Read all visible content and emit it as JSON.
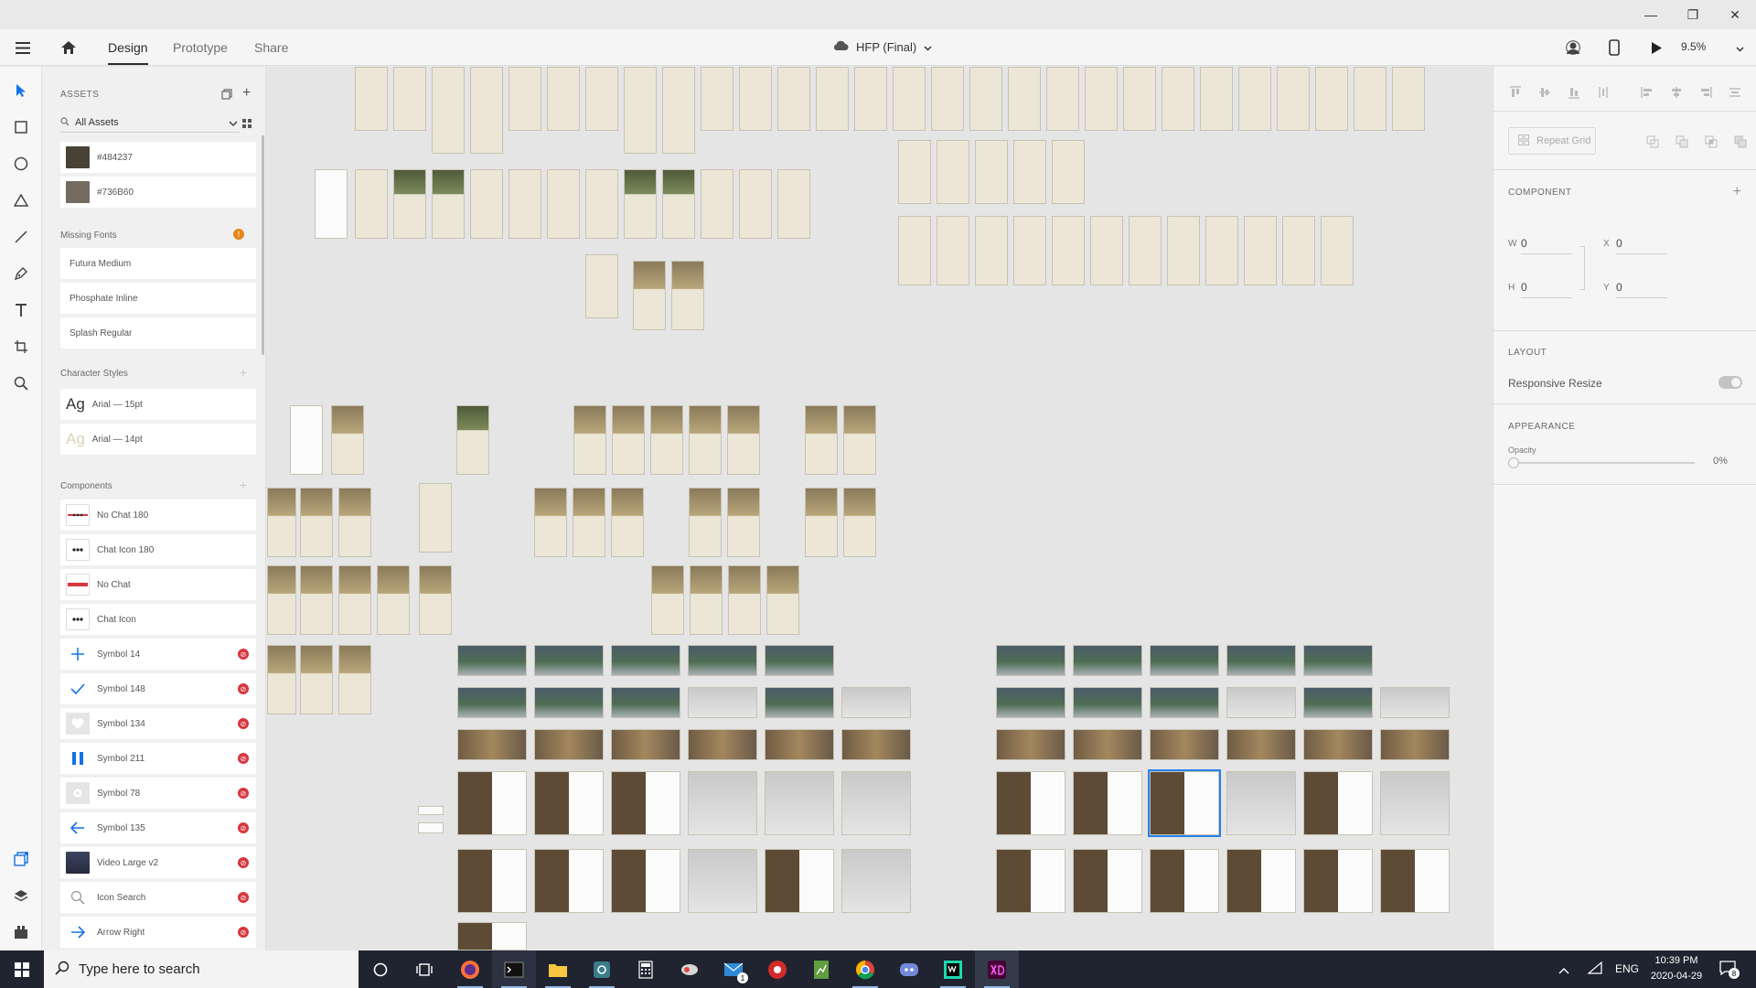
{
  "window": {
    "controls": {
      "minimize": "—",
      "restore": "❐",
      "close": "✕"
    }
  },
  "appbar": {
    "tabs": [
      {
        "label": "Design",
        "active": true
      },
      {
        "label": "Prototype",
        "active": false
      },
      {
        "label": "Share",
        "active": false
      }
    ],
    "document_title": "HFP (Final)",
    "zoom": "9.5%"
  },
  "assets_panel": {
    "header": "ASSETS",
    "filter_label": "All Assets",
    "colors": [
      {
        "label": "#484237",
        "hex": "#484237"
      },
      {
        "label": "#736B60",
        "hex": "#736B60"
      }
    ],
    "missing_fonts_label": "Missing Fonts",
    "missing_fonts_badge": "!",
    "missing_fonts": [
      "Futura Medium",
      "Phosphate Inline",
      "Splash Regular"
    ],
    "character_styles_label": "Character Styles",
    "character_styles": [
      {
        "glyph": "Ag",
        "label": "Arial — 15pt",
        "dim": false
      },
      {
        "glyph": "Ag",
        "label": "Arial — 14pt",
        "dim": true
      }
    ],
    "components_label": "Components",
    "components": [
      {
        "label": "No Chat 180",
        "icon": "no-chat-180-icon",
        "warn": false
      },
      {
        "label": "Chat Icon 180",
        "icon": "chat-dots-icon",
        "warn": false
      },
      {
        "label": "No Chat",
        "icon": "no-chat-icon",
        "warn": false
      },
      {
        "label": "Chat Icon",
        "icon": "chat-dots-icon",
        "warn": false
      },
      {
        "label": "Symbol 14",
        "icon": "plus-icon",
        "warn": true
      },
      {
        "label": "Symbol 148",
        "icon": "checkmark-icon",
        "warn": true
      },
      {
        "label": "Symbol 134",
        "icon": "heart-icon",
        "warn": true
      },
      {
        "label": "Symbol 211",
        "icon": "pause-icon",
        "warn": true
      },
      {
        "label": "Symbol 78",
        "icon": "gear-icon",
        "warn": true
      },
      {
        "label": "Symbol 135",
        "icon": "arrow-left-icon",
        "warn": true
      },
      {
        "label": "Video Large v2",
        "icon": "video-thumb-icon",
        "warn": true
      },
      {
        "label": "Icon Search",
        "icon": "search-icon",
        "warn": true
      },
      {
        "label": "Arrow Right",
        "icon": "arrow-right-icon",
        "warn": true
      }
    ]
  },
  "inspector": {
    "repeat_grid_label": "Repeat Grid",
    "component_label": "COMPONENT",
    "w_label": "W",
    "w_value": "0",
    "h_label": "H",
    "h_value": "0",
    "x_label": "X",
    "x_value": "0",
    "y_label": "Y",
    "y_value": "0",
    "layout_label": "LAYOUT",
    "responsive_resize_label": "Responsive Resize",
    "appearance_label": "APPEARANCE",
    "opacity_label": "Opacity",
    "opacity_value": "0%"
  },
  "taskbar": {
    "search_placeholder": "Type here to search",
    "language": "ENG",
    "time": "10:39 PM",
    "date": "2020-04-29",
    "notification_count": "8",
    "mail_badge": "1"
  }
}
